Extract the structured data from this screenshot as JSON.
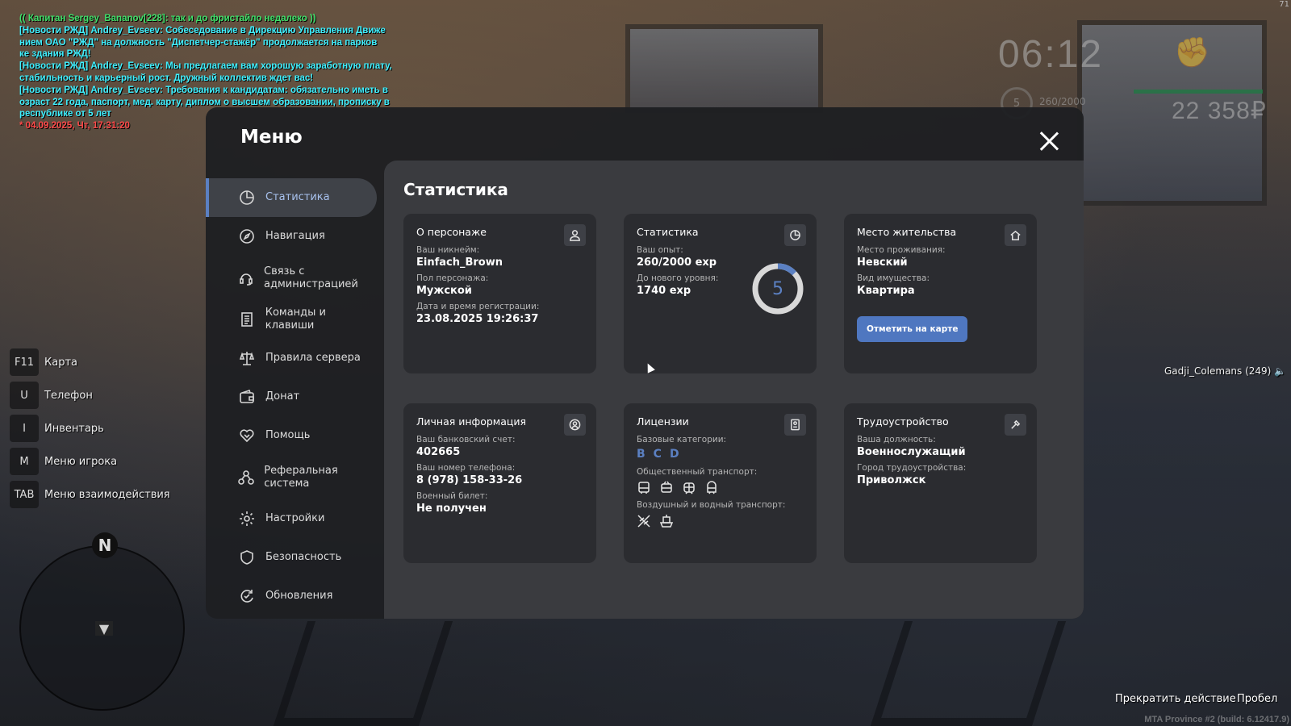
{
  "chat": {
    "lines": [
      {
        "color": "green",
        "text": "(( Капитан Sergey_Bananov[228]: так и до фристайло недалеко ))"
      },
      {
        "color": "cyan",
        "text": "[Новости РЖД] Andrey_Evseev: Собеседование в Дирекцию Управления Движе"
      },
      {
        "color": "cyan",
        "text": "нием ОАО \"РЖД\" на должность \"Диспетчер-стажёр\" продолжается на парков"
      },
      {
        "color": "cyan",
        "text": "ке здания РЖД!"
      },
      {
        "color": "cyan",
        "text": "[Новости РЖД] Andrey_Evseev: Мы предлагаем вам хорошую заработную плату,"
      },
      {
        "color": "cyan",
        "text": " стабильность и карьерный рост. Дружный коллектив ждет вас!"
      },
      {
        "color": "cyan",
        "text": "[Новости РЖД] Andrey_Evseev: Требования к кандидатам: обязательно иметь в"
      },
      {
        "color": "cyan",
        "text": "озраст 22 года, паспорт, мед. карту, диплом о высшем образовании, прописку в"
      },
      {
        "color": "cyan",
        "text": "республике от 5 лет"
      },
      {
        "color": "red",
        "text": "* 04.09.2025, Чт, 17:31:20"
      }
    ]
  },
  "hud": {
    "time": "06:12",
    "level": "5",
    "exp": "260/2000",
    "money": "22 358₽",
    "fps": "71",
    "health_fraction": 1.0
  },
  "hints": [
    {
      "key": "F11",
      "label": "Карта"
    },
    {
      "key": "U",
      "label": "Телефон"
    },
    {
      "key": "I",
      "label": "Инвентарь"
    },
    {
      "key": "M",
      "label": "Меню игрока"
    },
    {
      "key": "TAB",
      "label": "Меню взаимодействия"
    }
  ],
  "radar": {
    "north": "N"
  },
  "world": {
    "player_tag": "Gadji_Colemans (249)",
    "stop_action": "Прекратить действие",
    "mileage": "Пробел",
    "build": "MTA Province #2 (build: 6.12417.9)"
  },
  "menu": {
    "title": "Меню",
    "nav": [
      {
        "label": "Статистика",
        "icon": "pie-chart-icon"
      },
      {
        "label": "Навигация",
        "icon": "compass-icon"
      },
      {
        "label": "Связь с администрацией",
        "icon": "headset-icon"
      },
      {
        "label": "Команды и клавиши",
        "icon": "document-list-icon"
      },
      {
        "label": "Правила сервера",
        "icon": "scales-icon"
      },
      {
        "label": "Донат",
        "icon": "wallet-icon"
      },
      {
        "label": "Помощь",
        "icon": "handshake-icon"
      },
      {
        "label": "Реферальная система",
        "icon": "referral-icon"
      },
      {
        "label": "Настройки",
        "icon": "gear-icon"
      },
      {
        "label": "Безопасность",
        "icon": "shield-icon"
      },
      {
        "label": "Обновления",
        "icon": "refresh-icon"
      }
    ],
    "active_index": 0,
    "content_title": "Статистика",
    "cards": {
      "character": {
        "title": "О персонаже",
        "nickname_label": "Ваш никнейм:",
        "nickname": "Einfach_Brown",
        "gender_label": "Пол персонажа:",
        "gender": "Мужской",
        "reg_label": "Дата и время регистрации:",
        "reg": "23.08.2025 19:26:37"
      },
      "stats": {
        "title": "Статистика",
        "exp_label": "Ваш опыт:",
        "exp": "260/2000 exp",
        "next_label": "До нового уровня:",
        "next": "1740 exp",
        "level": "5",
        "progress": 0.13
      },
      "residence": {
        "title": "Место жительства",
        "place_label": "Место проживания:",
        "place": "Невский",
        "type_label": "Вид имущества:",
        "type": "Квартира",
        "map_button": "Отметить на карте"
      },
      "personal": {
        "title": "Личная информация",
        "bank_label": "Ваш банковский счет:",
        "bank": "402665",
        "phone_label": "Ваш номер телефона:",
        "phone": "8 (978) 158-33-26",
        "military_label": "Военный билет:",
        "military": "Не получен"
      },
      "licenses": {
        "title": "Лицензии",
        "base_label": "Базовые категории:",
        "base": [
          "B",
          "C",
          "D"
        ],
        "public_label": "Общественный транспорт:",
        "public_icons": [
          "bus-icon",
          "trolleybus-icon",
          "tram-icon",
          "train-icon"
        ],
        "air_label": "Воздушный и водный транспорт:",
        "air_icons": [
          "plane-icon",
          "boat-icon"
        ]
      },
      "job": {
        "title": "Трудоустройство",
        "position_label": "Ваша должность:",
        "position": "Военнослужащий",
        "city_label": "Город трудоустройства:",
        "city": "Приволжск"
      }
    }
  },
  "colors": {
    "accent": "#5b80c2",
    "chat_green": "#3fe06a",
    "chat_cyan": "#3ff0ff",
    "chat_red": "#ff4a4a"
  }
}
